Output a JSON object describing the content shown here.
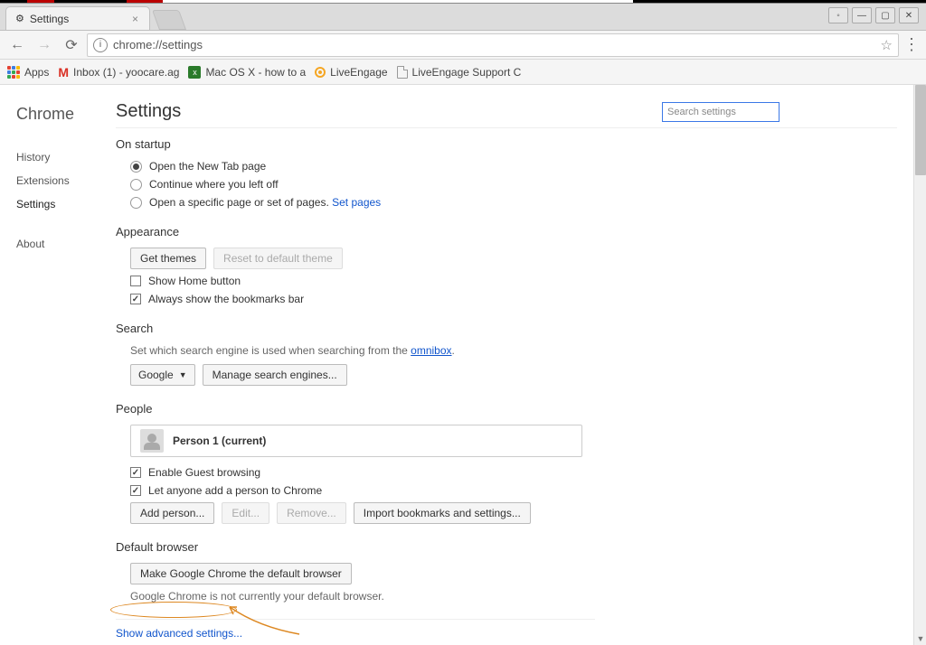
{
  "window": {
    "tab_title": "Settings",
    "url": "chrome://settings"
  },
  "bookmarks": {
    "apps": "Apps",
    "b1": "Inbox (1) - yoocare.ag",
    "b2": "Mac OS X - how to a",
    "b3": "LiveEngage",
    "b4": "LiveEngage Support C"
  },
  "sidebar": {
    "brand": "Chrome",
    "history": "History",
    "extensions": "Extensions",
    "settings": "Settings",
    "about": "About"
  },
  "header": {
    "title": "Settings",
    "search_placeholder": "Search settings"
  },
  "startup": {
    "title": "On startup",
    "opt1": "Open the New Tab page",
    "opt2": "Continue where you left off",
    "opt3": "Open a specific page or set of pages. ",
    "opt3_link": "Set pages"
  },
  "appearance": {
    "title": "Appearance",
    "get_themes": "Get themes",
    "reset_theme": "Reset to default theme",
    "show_home": "Show Home button",
    "always_bm": "Always show the bookmarks bar"
  },
  "search": {
    "title": "Search",
    "desc_pre": "Set which search engine is used when searching from the ",
    "desc_link": "omnibox",
    "desc_post": ".",
    "engine": "Google",
    "manage": "Manage search engines..."
  },
  "people": {
    "title": "People",
    "person": "Person 1 (current)",
    "guest": "Enable Guest browsing",
    "add_anyone": "Let anyone add a person to Chrome",
    "add_person": "Add person...",
    "edit": "Edit...",
    "remove": "Remove...",
    "import": "Import bookmarks and settings..."
  },
  "default_browser": {
    "title": "Default browser",
    "make_default": "Make Google Chrome the default browser",
    "status": "Google Chrome is not currently your default browser."
  },
  "advanced_link": "Show advanced settings..."
}
